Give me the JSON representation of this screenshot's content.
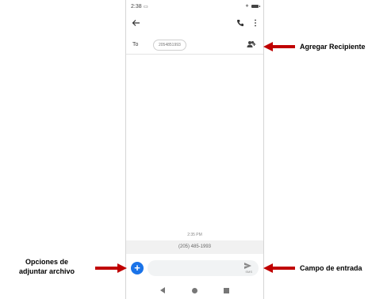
{
  "status_bar": {
    "time": "2:38",
    "notification_icon": "image-icon"
  },
  "toolbar": {
    "back_icon": "arrow-back-icon",
    "call_icon": "phone-icon",
    "menu_icon": "more-vert-icon"
  },
  "recipient_row": {
    "to_label": "To",
    "recipient": "2054851993",
    "add_icon": "add-person-icon"
  },
  "conversation": {
    "timestamp": "2:35 PM",
    "number": "(205) 485-1993"
  },
  "composer": {
    "sms_label": "SMS",
    "attach_label": "+"
  },
  "annotations": {
    "recipient": "Agregar Recipiente",
    "attach_line1": "Opciones de",
    "attach_line2": "adjuntar archivo",
    "input": "Campo de entrada"
  },
  "colors": {
    "accent": "#1a73e8",
    "arrow": "#c00000"
  }
}
